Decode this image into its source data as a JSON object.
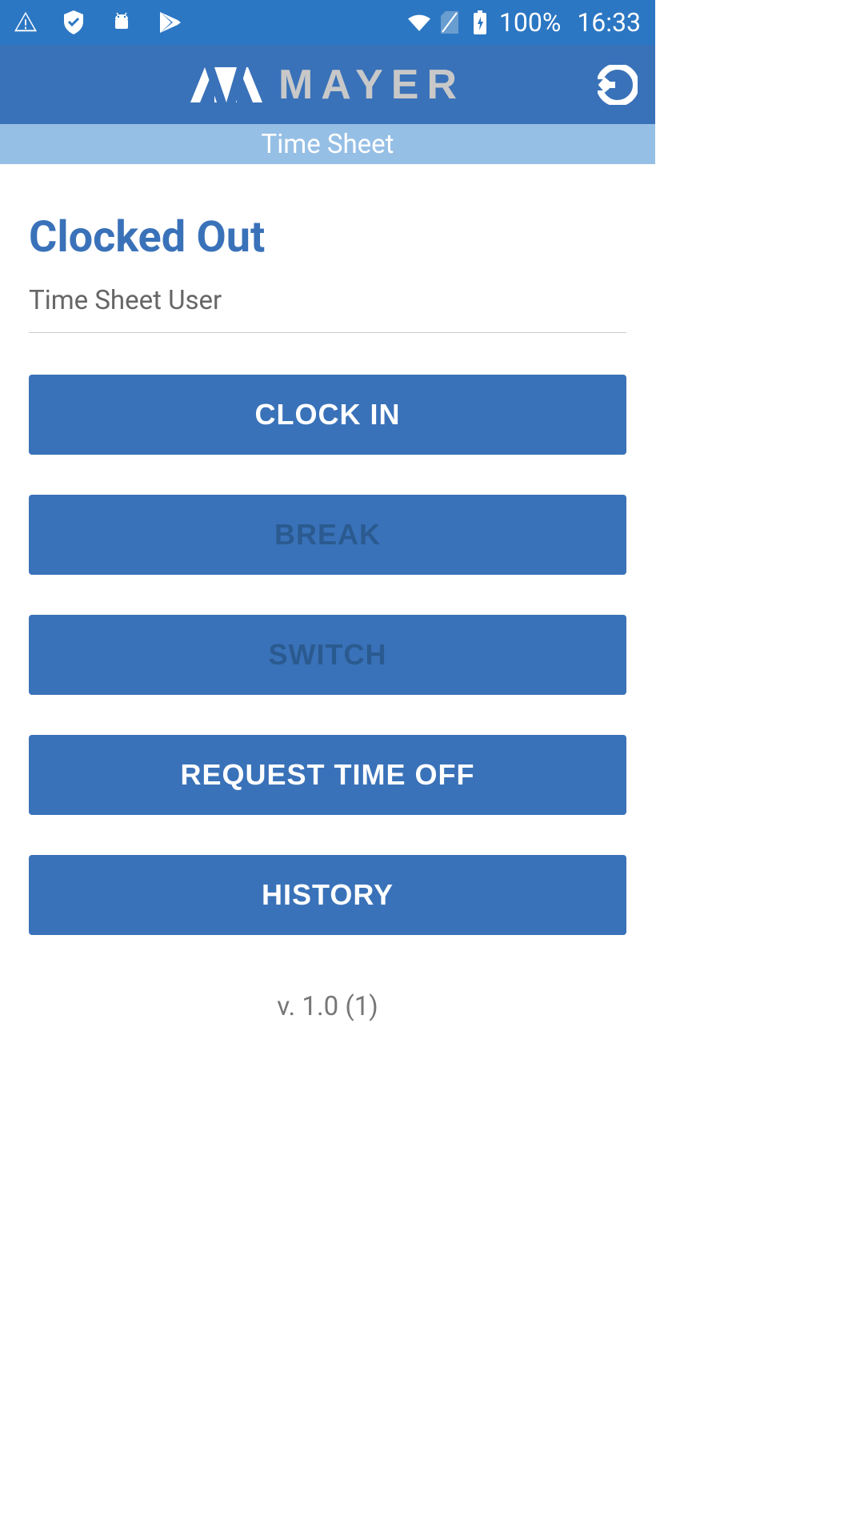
{
  "statusBar": {
    "battery": "100%",
    "time": "16:33"
  },
  "appBar": {
    "brandName": "MAYER"
  },
  "sectionHeader": {
    "title": "Time Sheet"
  },
  "main": {
    "statusTitle": "Clocked Out",
    "userLabel": "Time Sheet User",
    "buttons": {
      "clockIn": "CLOCK IN",
      "break": "BREAK",
      "switch": "SWITCH",
      "requestTimeOff": "REQUEST TIME OFF",
      "history": "HISTORY"
    },
    "version": "v. 1.0 (1)"
  }
}
